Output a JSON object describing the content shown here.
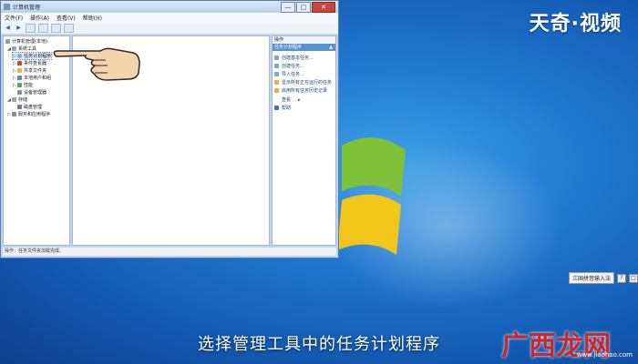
{
  "watermark": {
    "top_brand": "天奇·视频",
    "bottom_brand": "广西龙网",
    "bottom_url": "www.jiaohao.com"
  },
  "caption": "选择管理工具中的任务计划程序",
  "window": {
    "title": "计算机管理",
    "controls": {
      "minimize": "—",
      "maximize": "□",
      "close": "✕"
    },
    "menu": [
      "文件(F)",
      "操作(A)",
      "查看(V)",
      "帮助(H)"
    ],
    "tree": [
      {
        "label": "计算机管理(本地)",
        "arrow": "",
        "icon": "computer"
      },
      {
        "label": "系统工具",
        "arrow": "◢",
        "icon": "tools"
      },
      {
        "label": "任务计划程序",
        "arrow": "▷",
        "icon": "clock",
        "selected": true
      },
      {
        "label": "事件查看器",
        "arrow": "▷",
        "icon": "event"
      },
      {
        "label": "共享文件夹",
        "arrow": "▷",
        "icon": "folder"
      },
      {
        "label": "本地用户和组",
        "arrow": "▷",
        "icon": "users"
      },
      {
        "label": "性能",
        "arrow": "▷",
        "icon": "perf"
      },
      {
        "label": "设备管理器",
        "arrow": "",
        "icon": "device"
      },
      {
        "label": "存储",
        "arrow": "◢",
        "icon": "storage"
      },
      {
        "label": "磁盘管理",
        "arrow": "",
        "icon": "disk"
      },
      {
        "label": "服务和应用程序",
        "arrow": "▷",
        "icon": "services"
      }
    ],
    "actions": {
      "header": "操作",
      "selected": "任务计划程序",
      "items": [
        "创建基本任务...",
        "创建任务...",
        "导入任务...",
        "显示所有正在运行的任务",
        "启用所有任务历史记录",
        "查看",
        "帮助"
      ]
    },
    "status": "操作：任务文件夹加载完成。"
  },
  "taskbar": {
    "lang": "三国拼音输入法",
    "btn1": "?",
    "btn2": "□"
  }
}
